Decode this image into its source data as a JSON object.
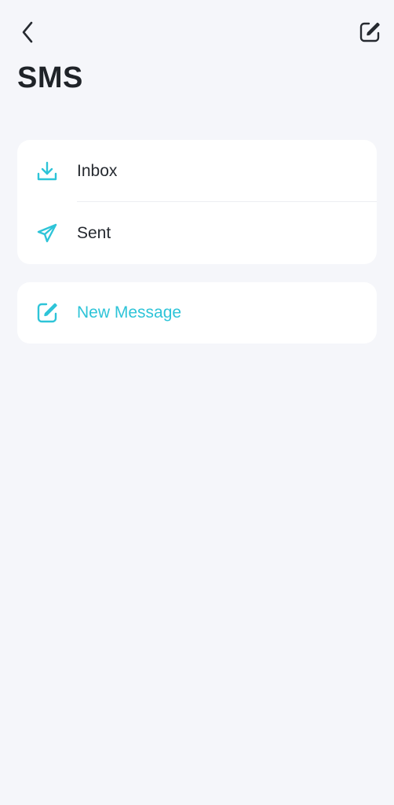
{
  "header": {
    "back_icon": "chevron-left-icon",
    "compose_icon": "edit-square-icon",
    "title": "SMS"
  },
  "menu": {
    "items": [
      {
        "label": "Inbox",
        "icon": "download-tray-icon"
      },
      {
        "label": "Sent",
        "icon": "send-plane-icon"
      }
    ]
  },
  "actions": {
    "new_message": {
      "label": "New Message",
      "icon": "edit-square-icon"
    }
  },
  "colors": {
    "background": "#f5f6fa",
    "card": "#ffffff",
    "accent": "#2ec4d8",
    "text": "#262a30",
    "title": "#1f2328"
  }
}
